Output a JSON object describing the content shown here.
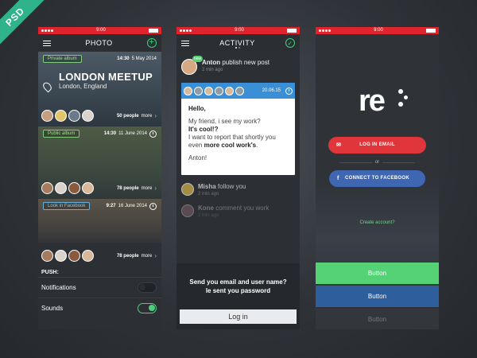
{
  "ribbon": "PSD",
  "statusbar": {
    "time": "9:00"
  },
  "photo": {
    "title": "PHOTO",
    "cards": [
      {
        "tag": "Private album",
        "time": "14:30",
        "date": "5 May 2014",
        "title": "LONDON MEETUP",
        "location": "London, England",
        "people_count": "50 people",
        "people_more": "more"
      },
      {
        "tag": "Public album",
        "time": "14:30",
        "date": "11 June 2014",
        "people_count": "78 people",
        "people_more": "more"
      },
      {
        "tag": "Look in Facebook",
        "time": "9:27",
        "date": "16 June 2014"
      }
    ],
    "bottom_people": {
      "count": "78 people",
      "more": "more"
    },
    "push_label": "PUSH:",
    "settings": [
      {
        "label": "Notifications",
        "on": false
      },
      {
        "label": "Sounds",
        "on": true
      }
    ]
  },
  "activity": {
    "title": "ACTIVITY",
    "new_badge": "new",
    "post": {
      "user": "Anton",
      "action": "publish new post",
      "time": "2 min ago"
    },
    "message": {
      "time": "20.06.15",
      "greeting": "Hello,",
      "line1": "My friend, i see my work?",
      "line2": "It's cool!?",
      "line3a": "I want to report that shortly you even",
      "line3b": "more cool work's",
      "line3c": ".",
      "sign": "Anton!"
    },
    "follow": {
      "user": "Misha",
      "action": "follow you",
      "time": "2 min ago"
    },
    "comment": {
      "user": "Kone",
      "action": "comment you work",
      "time": "2 min ago"
    },
    "login": {
      "line1": "Send you email and user name?",
      "line2": "le sent you password",
      "button": "Log in"
    }
  },
  "re": {
    "logo": "re",
    "login_email": "LOG IN EMAIL",
    "or": "or",
    "connect_fb": "CONNECT TO FACEBOOK",
    "create_account": "Create account?",
    "buttons": [
      "Button",
      "Button",
      "Button"
    ]
  },
  "colors": {
    "accent_red": "#e0242e",
    "green": "#55d276",
    "blue": "#3b8fd6",
    "facebook": "#3f66b0"
  }
}
